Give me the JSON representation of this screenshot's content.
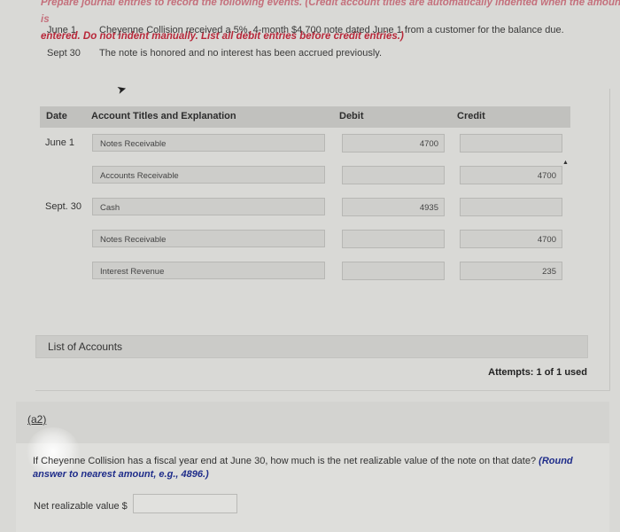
{
  "instructions": {
    "line1_faded": "Prepare journal entries to record the following events. (Credit account titles are automatically indented when the amount is",
    "line2": "entered. Do not indent manually. List all debit entries before credit entries.)"
  },
  "events": [
    {
      "date": "June 1",
      "text": "Cheyenne Collision received a 5%, 4-month $4,700 note dated June 1 from a customer for the balance due."
    },
    {
      "date": "Sept 30",
      "text": "The note is honored and no interest has been accrued previously."
    }
  ],
  "table": {
    "headers": {
      "date": "Date",
      "account": "Account Titles and Explanation",
      "debit": "Debit",
      "credit": "Credit"
    },
    "rows": [
      {
        "date": "June 1",
        "account": "Notes Receivable",
        "debit": "4700",
        "credit": ""
      },
      {
        "date": "",
        "account": "Accounts Receivable",
        "debit": "",
        "credit": "4700"
      },
      {
        "date": "Sept. 30",
        "account": "Cash",
        "debit": "4935",
        "credit": ""
      },
      {
        "date": "",
        "account": "Notes Receivable",
        "debit": "",
        "credit": "4700"
      },
      {
        "date": "",
        "account": "Interest Revenue",
        "debit": "",
        "credit": "235"
      }
    ]
  },
  "list_of_accounts_label": "List of Accounts",
  "attempts": "Attempts: 1 of 1 used",
  "part_a2": {
    "label": "(a2)",
    "question": "If Cheyenne Collision has a fiscal year end at June 30, how much is the net realizable value of the note on that date?",
    "hint": "(Round answer to nearest amount, e.g., 4896.)",
    "input_label": "Net realizable value $",
    "input_value": ""
  }
}
